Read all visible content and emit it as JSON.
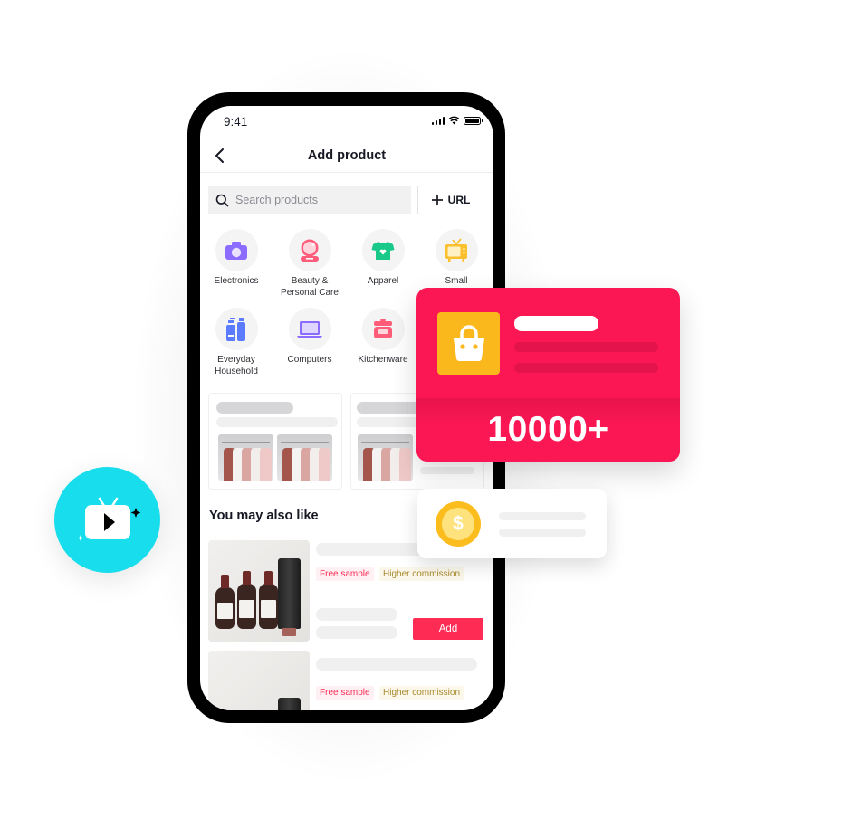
{
  "status_bar": {
    "time": "9:41",
    "icons": [
      "cellular-signal-icon",
      "wifi-icon",
      "battery-icon"
    ]
  },
  "nav": {
    "title": "Add product",
    "back_icon": "chevron-left-icon"
  },
  "search": {
    "placeholder": "Search products",
    "value": "",
    "icon": "search-icon"
  },
  "url_button": {
    "label": "URL",
    "icon": "plus-icon"
  },
  "categories": [
    {
      "label": "Electronics",
      "icon": "camera-icon",
      "color": "#8b6cff"
    },
    {
      "label": "Beauty & Personal Care",
      "icon": "compact-mirror-icon",
      "color": "#ff5c7a"
    },
    {
      "label": "Apparel",
      "icon": "tshirt-icon",
      "color": "#19c98a"
    },
    {
      "label": "Small",
      "icon": "tv-icon",
      "color": "#fbc02d"
    },
    {
      "label": "Everyday Household",
      "icon": "bottles-icon",
      "color": "#5b7cff"
    },
    {
      "label": "Computers",
      "icon": "laptop-icon",
      "color": "#8b6cff"
    },
    {
      "label": "Kitchenware",
      "icon": "rice-cooker-icon",
      "color": "#ff5c7a"
    }
  ],
  "section": {
    "title": "You may also like"
  },
  "products": [
    {
      "tags": [
        "Free sample",
        "Higher commission"
      ],
      "action": "Add"
    },
    {
      "tags": [
        "Free sample",
        "Higher commission"
      ]
    }
  ],
  "promo_card": {
    "value": "10000+",
    "icon": "shopping-bag-icon",
    "bg_color": "#fb1754",
    "tile_color": "#fbb81c"
  },
  "coin_card": {
    "icon": "dollar-coin-icon",
    "symbol": "$"
  },
  "tv_badge": {
    "icon": "tv-play-icon",
    "color": "#18dded"
  },
  "colors": {
    "accent": "#fe2c55",
    "tag_gold": "#a88a2d"
  }
}
